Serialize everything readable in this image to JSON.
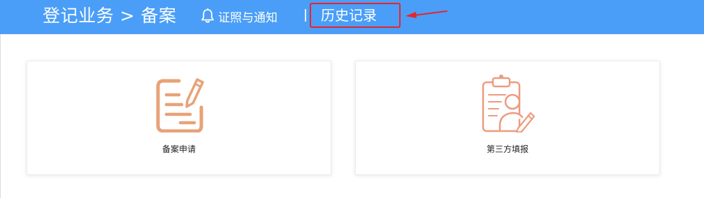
{
  "header": {
    "title": "登记业务 > 备案",
    "notice_label": "证照与通知",
    "history_label": "历史记录"
  },
  "cards": [
    {
      "label": "备案申请",
      "icon": "document-edit-icon"
    },
    {
      "label": "第三方填报",
      "icon": "clipboard-person-icon"
    }
  ],
  "colors": {
    "header_bg": "#4a9ef7",
    "highlight_box": "#e8242b",
    "icon_orange": "#e8a277",
    "icon_salmon": "#ee9a7f"
  }
}
